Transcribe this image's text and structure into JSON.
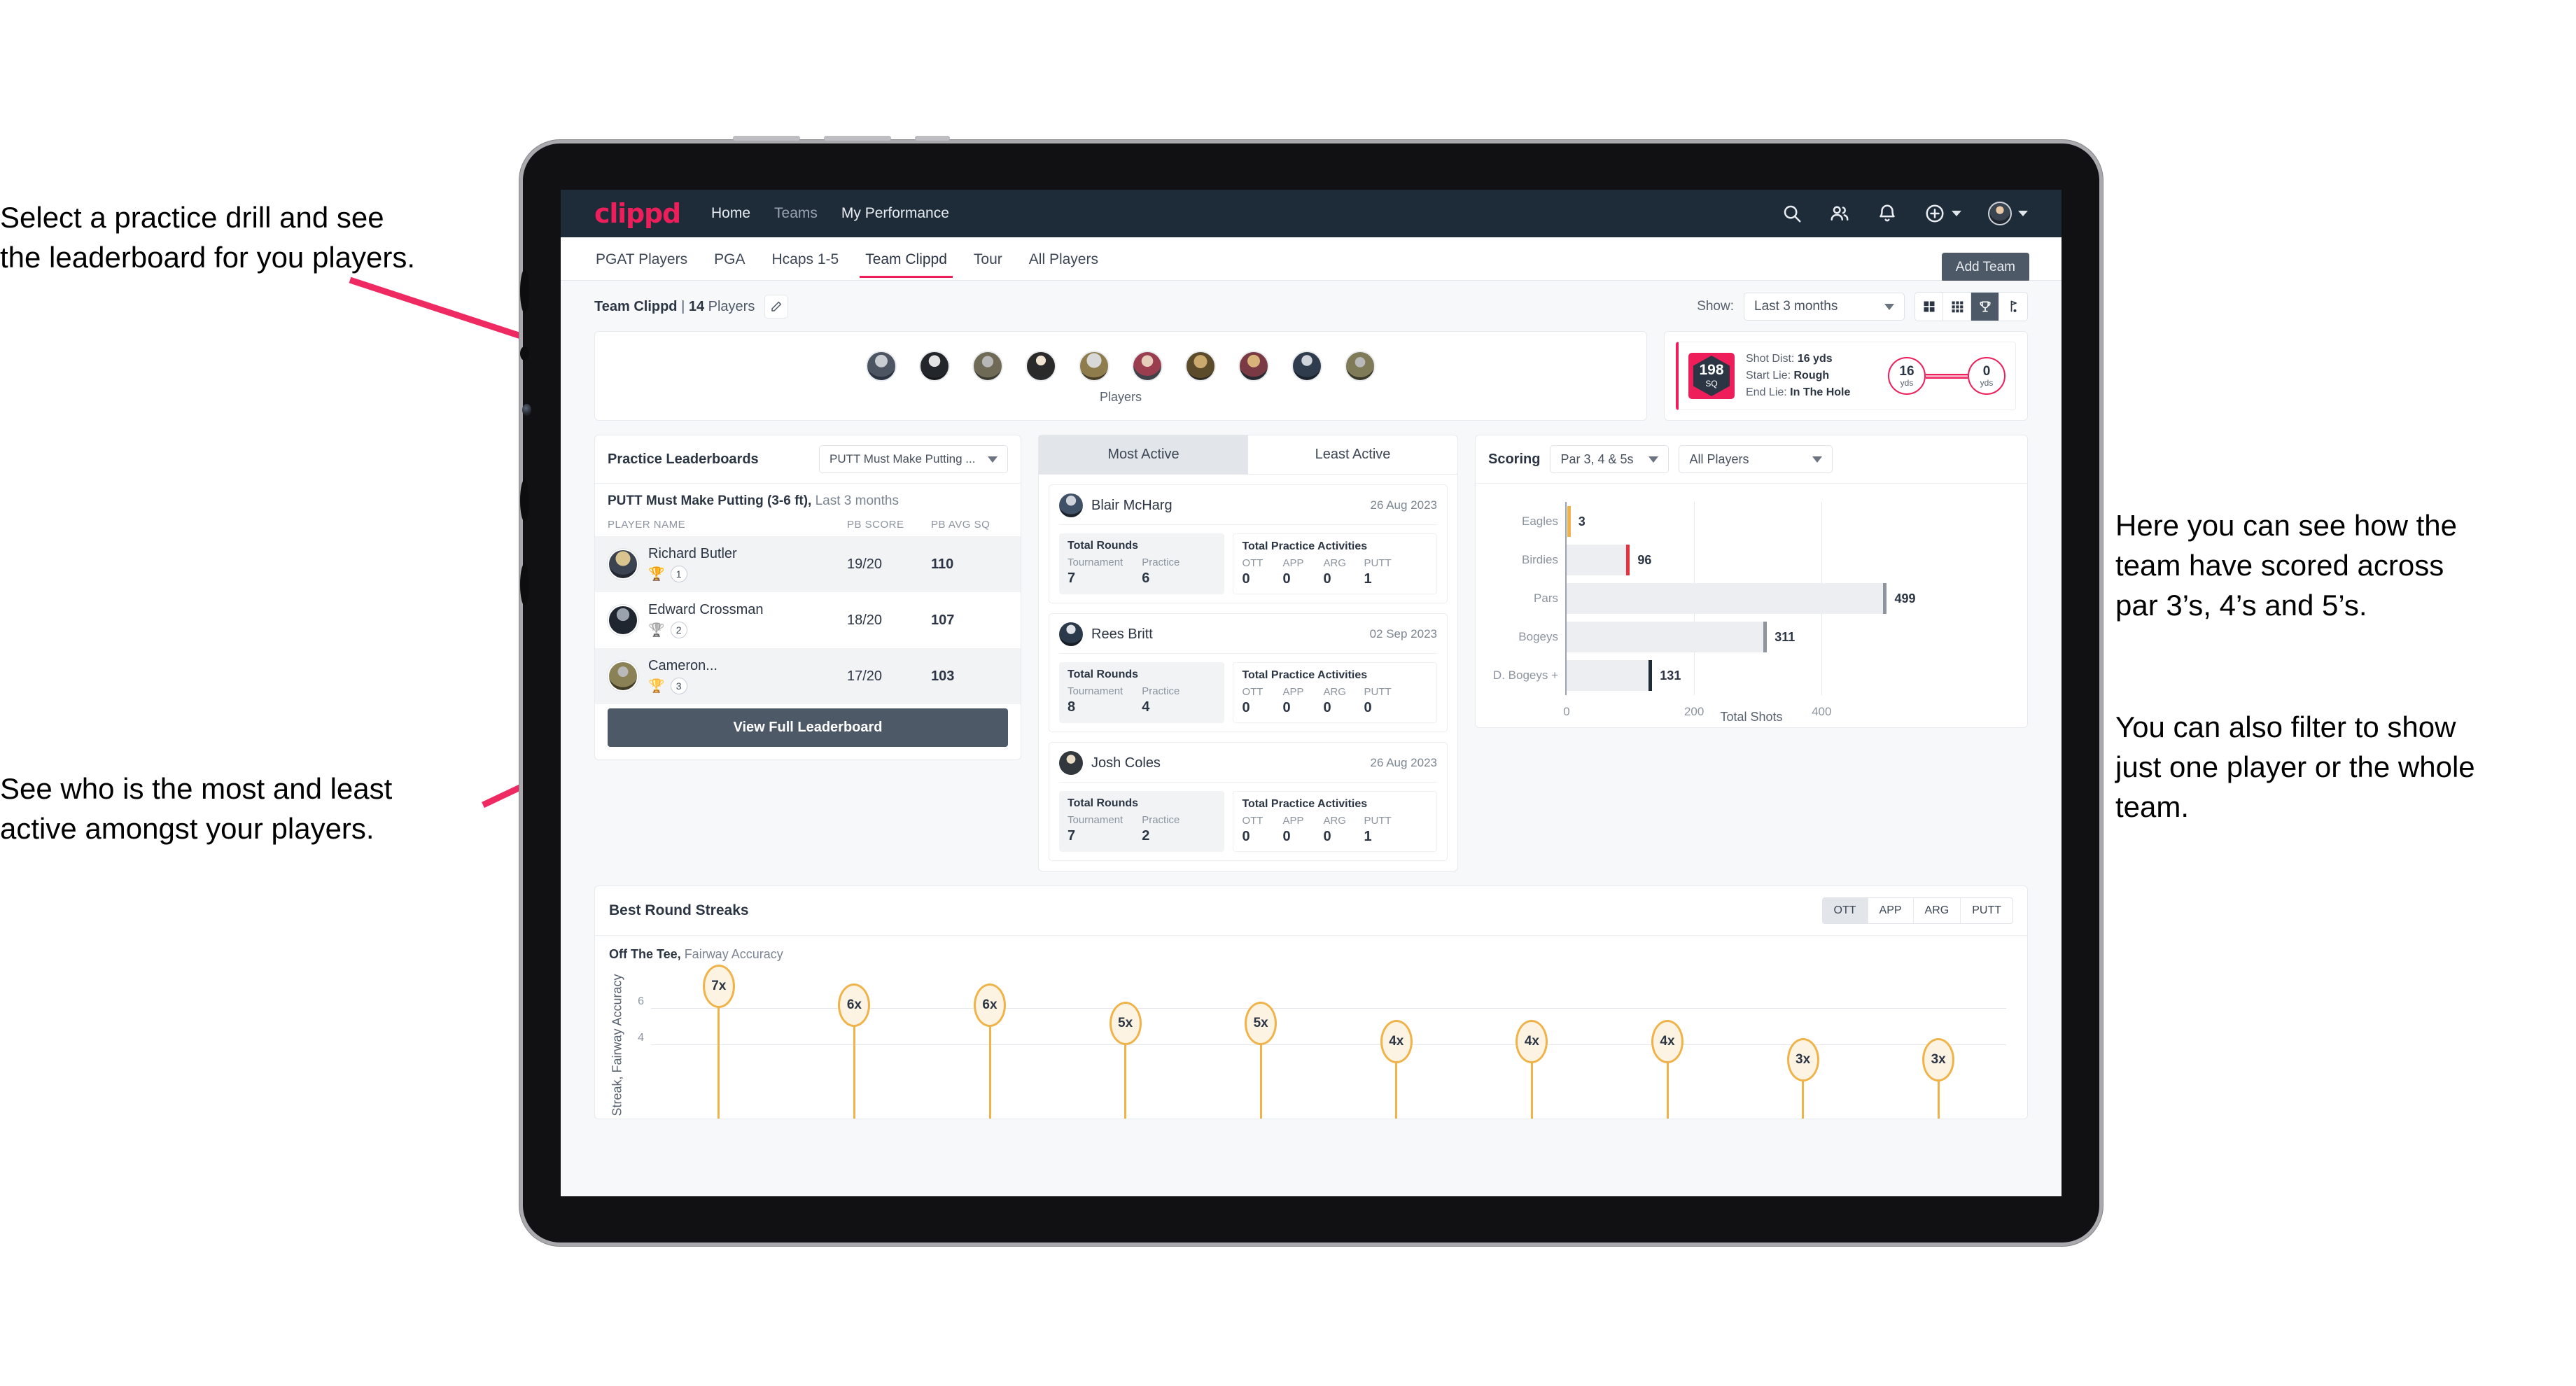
{
  "annotations": {
    "a": "Select a practice drill and see\nthe leaderboard for you players.",
    "b": "See who is the most and least\nactive amongst your players.",
    "c": "Here you can see how the\nteam have scored across\npar 3’s, 4’s and 5’s.",
    "d": "You can also filter to show\njust one player or the whole\nteam."
  },
  "colors": {
    "brand_pink": "#ed1e5a",
    "nav_dark": "#1e2b39",
    "button_slate": "#4e5967",
    "streak_gold": "#efb34a",
    "annotation_arrow": "#ef2a63"
  },
  "navbar": {
    "logo": "clippd",
    "links": [
      {
        "label": "Home",
        "active": true
      },
      {
        "label": "Teams",
        "active": false
      },
      {
        "label": "My Performance",
        "active": false
      }
    ],
    "icons": [
      "search-icon",
      "people-icon",
      "bell-icon",
      "plus-circle-icon",
      "avatar"
    ]
  },
  "tabs": {
    "items": [
      {
        "label": "PGAT Players",
        "active": false
      },
      {
        "label": "PGA",
        "active": false
      },
      {
        "label": "Hcaps 1-5",
        "active": false
      },
      {
        "label": "Team Clippd",
        "active": true
      },
      {
        "label": "Tour",
        "active": false
      },
      {
        "label": "All Players",
        "active": false
      }
    ],
    "add_team_label": "Add Team"
  },
  "toolbar": {
    "team_name": "Team Clippd",
    "separator": " | ",
    "player_count": "14",
    "players_word": " Players",
    "show_label": "Show:",
    "period_value": "Last 3 months",
    "view_buttons": [
      "grid-large-icon",
      "grid-small-icon",
      "trophy-icon",
      "flag-icon"
    ],
    "active_view": "trophy-icon"
  },
  "players_card": {
    "caption": "Players",
    "avatar_count": 10
  },
  "shot_card": {
    "badge_value": "198",
    "badge_unit": "SQ",
    "lines": [
      {
        "label": "Shot Dist: ",
        "value": "16 yds"
      },
      {
        "label": "Start Lie: ",
        "value": "Rough"
      },
      {
        "label": "End Lie: ",
        "value": "In The Hole"
      }
    ],
    "start_dist": "16",
    "start_unit": "yds",
    "end_dist": "0",
    "end_unit": "yds"
  },
  "leaderboard": {
    "title": "Practice Leaderboards",
    "drill_select": "PUTT Must Make Putting ...",
    "subtitle_bold": "PUTT Must Make Putting (3-6 ft),",
    "subtitle_rest": " Last 3 months",
    "columns": [
      "PLAYER NAME",
      "PB SCORE",
      "PB AVG SQ"
    ],
    "rows": [
      {
        "name": "Richard Butler",
        "rank": "1",
        "trophy": "gold",
        "pb_score": "19/20",
        "pb_avg_sq": "110"
      },
      {
        "name": "Edward Crossman",
        "rank": "2",
        "trophy": "silver",
        "pb_score": "18/20",
        "pb_avg_sq": "107"
      },
      {
        "name": "Cameron...",
        "rank": "3",
        "trophy": "bronze",
        "pb_score": "17/20",
        "pb_avg_sq": "103"
      }
    ],
    "button_label": "View Full Leaderboard"
  },
  "activity": {
    "tabs": [
      {
        "label": "Most Active",
        "active": true
      },
      {
        "label": "Least Active",
        "active": false
      }
    ],
    "rounds_title": "Total Rounds",
    "rounds_keys": [
      "Tournament",
      "Practice"
    ],
    "acts_title": "Total Practice Activities",
    "acts_keys": [
      "OTT",
      "APP",
      "ARG",
      "PUTT"
    ],
    "items": [
      {
        "name": "Blair McHarg",
        "date": "26 Aug 2023",
        "tournament": "7",
        "practice": "6",
        "ott": "0",
        "app": "0",
        "arg": "0",
        "putt": "1"
      },
      {
        "name": "Rees Britt",
        "date": "02 Sep 2023",
        "tournament": "8",
        "practice": "4",
        "ott": "0",
        "app": "0",
        "arg": "0",
        "putt": "0"
      },
      {
        "name": "Josh Coles",
        "date": "26 Aug 2023",
        "tournament": "7",
        "practice": "2",
        "ott": "0",
        "app": "0",
        "arg": "0",
        "putt": "1"
      }
    ]
  },
  "scoring": {
    "title": "Scoring",
    "par_select": "Par 3, 4 & 5s",
    "player_select": "All Players"
  },
  "streaks": {
    "title": "Best Round Streaks",
    "segments": [
      {
        "label": "OTT",
        "active": true
      },
      {
        "label": "APP",
        "active": false
      },
      {
        "label": "ARG",
        "active": false
      },
      {
        "label": "PUTT",
        "active": false
      }
    ],
    "sub_bold": "Off The Tee,",
    "sub_rest": " Fairway Accuracy"
  },
  "chart_data": [
    {
      "type": "bar",
      "orientation": "horizontal",
      "title": "Scoring",
      "categories": [
        "Eagles",
        "Birdies",
        "Pars",
        "Bogeys",
        "D. Bogeys +"
      ],
      "values": [
        3,
        96,
        499,
        311,
        131
      ],
      "tip_colors": [
        "#efb34a",
        "#e8313f",
        "#8e959d",
        "#8e959d",
        "#1e2b39"
      ],
      "xlabel": "Total Shots",
      "ylabel": "",
      "xticks": [
        0,
        200,
        400
      ],
      "xlim": [
        0,
        560
      ],
      "grid": true,
      "legend": "none"
    },
    {
      "type": "bar",
      "orientation": "vertical",
      "title": "Best Round Streaks",
      "subtitle": "Off The Tee, Fairway Accuracy",
      "categories": [
        "7x",
        "6x",
        "6x",
        "5x",
        "5x",
        "4x",
        "4x",
        "4x",
        "3x",
        "3x"
      ],
      "values": [
        7,
        6,
        6,
        5,
        5,
        4,
        4,
        4,
        3,
        3
      ],
      "labels": [
        "7x",
        "6x",
        "6x",
        "5x",
        "5x",
        "4x",
        "4x",
        "4x",
        "3x",
        "3x"
      ],
      "ylabel": "Streak, Fairway Accuracy",
      "yticks": [
        4,
        6
      ],
      "ylim": [
        0,
        8
      ],
      "grid": true,
      "legend": "none"
    }
  ]
}
